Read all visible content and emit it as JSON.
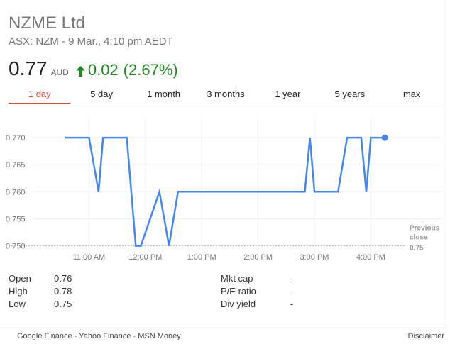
{
  "stock": {
    "name": "NZME Ltd",
    "subtitle": "ASX: NZM - 9 Mar., 4:10 pm AEDT",
    "price": "0.77",
    "currency": "AUD",
    "change": "0.02",
    "change_pct": "(2.67%)",
    "up_color": "#1e8a1e"
  },
  "tabs": [
    {
      "label": "1 day",
      "active": true
    },
    {
      "label": "5 day"
    },
    {
      "label": "1 month"
    },
    {
      "label": "3 months"
    },
    {
      "label": "1 year"
    },
    {
      "label": "5 years"
    },
    {
      "label": "max"
    }
  ],
  "chart_data": {
    "type": "line",
    "x": [
      10.58,
      11.0,
      11.17,
      11.25,
      11.67,
      11.83,
      11.92,
      12.25,
      12.42,
      12.58,
      14.83,
      14.92,
      15.0,
      15.42,
      15.58,
      15.83,
      15.92,
      16.0,
      16.25
    ],
    "y": [
      0.77,
      0.77,
      0.76,
      0.77,
      0.77,
      0.75,
      0.75,
      0.76,
      0.75,
      0.76,
      0.76,
      0.77,
      0.76,
      0.76,
      0.77,
      0.77,
      0.76,
      0.77,
      0.77
    ],
    "xlim": [
      10.0,
      16.6
    ],
    "ylim": [
      0.7485,
      0.7725
    ],
    "y_ticks": [
      "0.770",
      "0.765",
      "0.760",
      "0.755",
      "0.750"
    ],
    "y_tick_values": [
      0.77,
      0.765,
      0.76,
      0.755,
      0.75
    ],
    "x_ticks": [
      "11:00 AM",
      "12:00 PM",
      "1:00 PM",
      "2:00 PM",
      "3:00 PM",
      "4:00 PM"
    ],
    "x_tick_values": [
      11,
      12,
      13,
      14,
      15,
      16
    ],
    "previous_close": 0.75,
    "previous_close_label": [
      "Previous",
      "close",
      "0.75"
    ],
    "line_color": "#4285f4",
    "grid": true
  },
  "stats": {
    "left": [
      {
        "label": "Open",
        "value": "0.76"
      },
      {
        "label": "High",
        "value": "0.78"
      },
      {
        "label": "Low",
        "value": "0.75"
      }
    ],
    "right": [
      {
        "label": "Mkt cap",
        "value": "-"
      },
      {
        "label": "P/E ratio",
        "value": "-"
      },
      {
        "label": "Div yield",
        "value": "-"
      }
    ]
  },
  "footer": {
    "sources": "Google Finance - Yahoo Finance - MSN Money",
    "disclaimer": "Disclaimer"
  }
}
